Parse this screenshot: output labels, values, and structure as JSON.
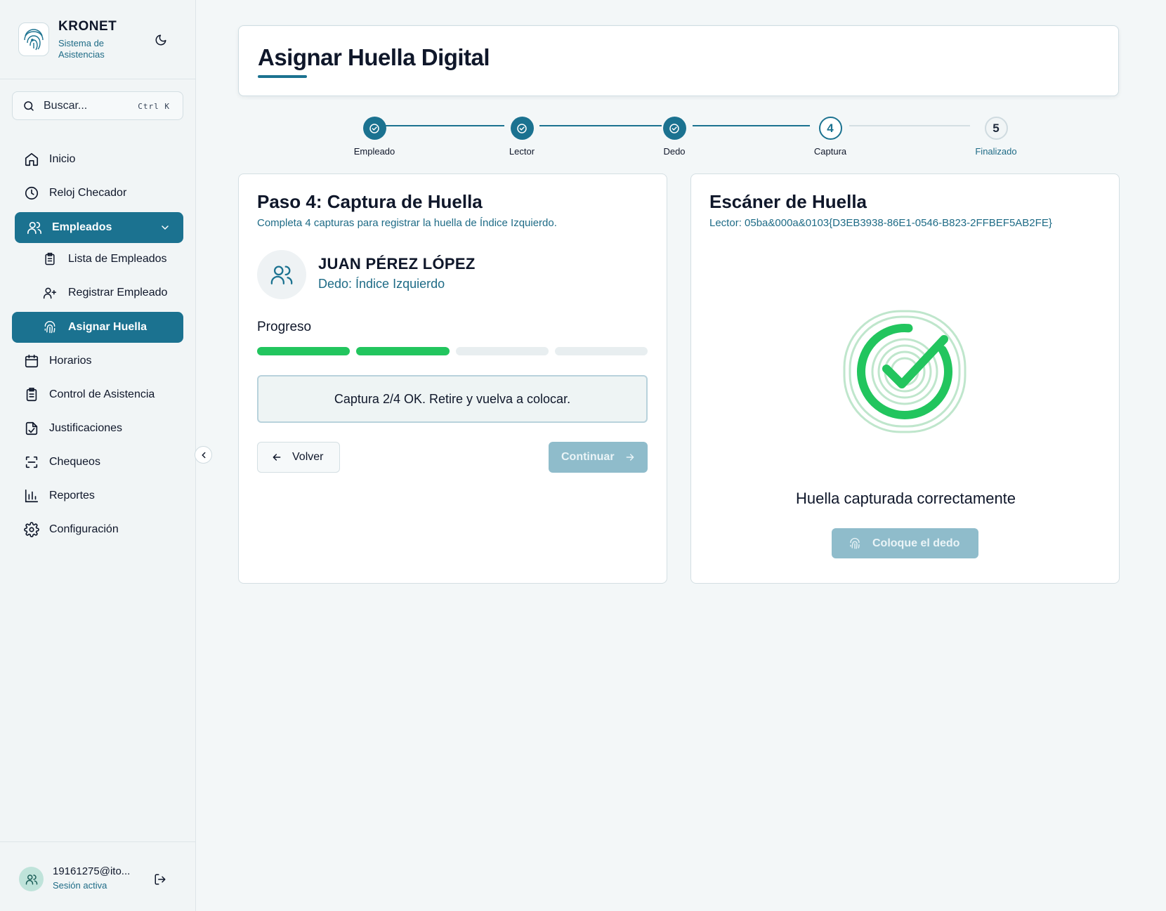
{
  "brand": {
    "name": "KRONET",
    "subtitle": "Sistema de Asistencias"
  },
  "search": {
    "placeholder": "Buscar...",
    "shortcut": "Ctrl  K"
  },
  "nav": {
    "inicio": "Inicio",
    "reloj": "Reloj Checador",
    "empleados": "Empleados",
    "lista": "Lista de Empleados",
    "registrar": "Registrar Empleado",
    "asignar": "Asignar Huella",
    "horarios": "Horarios",
    "control": "Control de Asistencia",
    "justificaciones": "Justificaciones",
    "chequeos": "Chequeos",
    "reportes": "Reportes",
    "configuracion": "Configuración"
  },
  "user": {
    "email": "19161275@ito...",
    "status": "Sesión activa"
  },
  "page": {
    "title": "Asignar Huella Digital"
  },
  "stepper": {
    "steps": [
      {
        "label": "Empleado",
        "state": "done"
      },
      {
        "label": "Lector",
        "state": "done"
      },
      {
        "label": "Dedo",
        "state": "done"
      },
      {
        "label": "Captura",
        "number": "4",
        "state": "current"
      },
      {
        "label": "Finalizado",
        "number": "5",
        "state": "pending"
      }
    ]
  },
  "capture": {
    "title": "Paso 4: Captura de Huella",
    "description": "Completa 4 capturas para registrar la huella de Índice Izquierdo.",
    "employee_name": "JUAN PÉREZ LÓPEZ",
    "finger": "Dedo: Índice Izquierdo",
    "progress_label": "Progreso",
    "captures_done": 2,
    "captures_total": 4,
    "status_message": "Captura 2/4 OK. Retire y vuelva a colocar.",
    "back_label": "Volver",
    "continue_label": "Continuar"
  },
  "scanner": {
    "title": "Escáner de Huella",
    "reader": "Lector: 05ba&000a&0103{D3EB3938-86E1-0546-B823-2FFBEF5AB2FE}",
    "result": "Huella capturada correctamente",
    "place_label": "Coloque el dedo"
  },
  "colors": {
    "primary": "#1b7290",
    "success": "#22c55e",
    "muted_button": "#8fbccb"
  }
}
